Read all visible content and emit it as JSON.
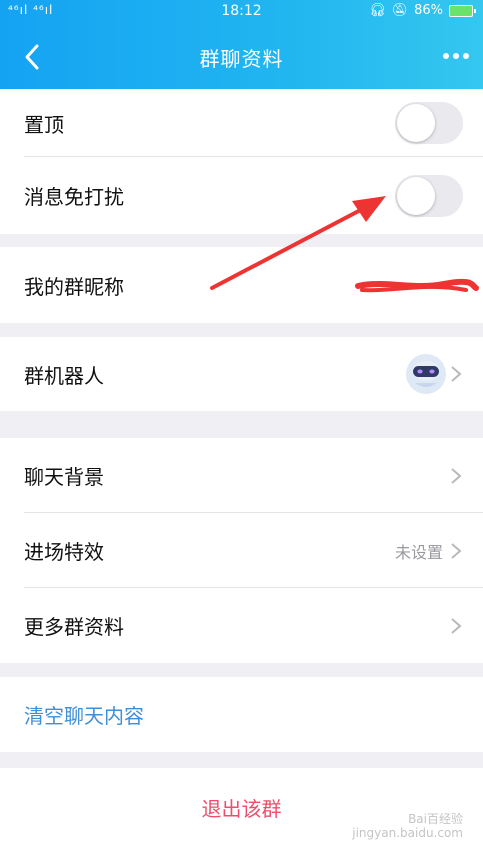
{
  "status_bar": {
    "signal": "⁴⁶ıl ⁴⁶ıl",
    "time": "18:12",
    "battery_percent": "86%"
  },
  "header": {
    "title": "群聊资料"
  },
  "settings": {
    "pin_label": "置顶",
    "pin_on": false,
    "mute_label": "消息免打扰",
    "mute_on": false,
    "nickname_label": "我的群昵称",
    "robot_label": "群机器人",
    "chat_bg_label": "聊天背景",
    "entry_effect_label": "进场特效",
    "entry_effect_value": "未设置",
    "more_info_label": "更多群资料",
    "clear_label": "清空聊天内容",
    "exit_label": "退出该群"
  },
  "watermark": {
    "line1": "Bai百经验",
    "line2": "jingyan.baidu.com"
  },
  "colors": {
    "header_start": "#14a3f3",
    "header_end": "#34c7ef",
    "link": "#3d8fd8",
    "danger": "#ee4e6c",
    "annotation": "#ee3333"
  }
}
